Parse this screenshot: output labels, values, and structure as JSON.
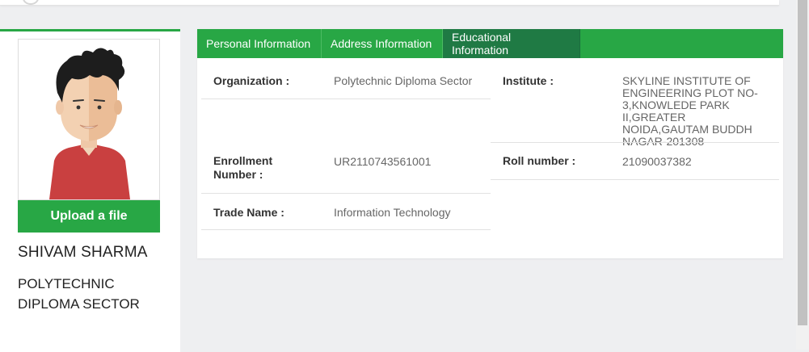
{
  "profile": {
    "name": "SHIVAM SHARMA",
    "organization": "POLYTECHNIC DIPLOMA SECTOR",
    "upload_label": "Upload a file"
  },
  "tabs": [
    {
      "label": "Personal Information",
      "active": false
    },
    {
      "label": "Address Information",
      "active": false
    },
    {
      "label": "Educational Information",
      "active": true
    }
  ],
  "fields": {
    "organization": {
      "label": "Organization :",
      "value": "Polytechnic Diploma Sector"
    },
    "institute": {
      "label": "Institute :",
      "value": "SKYLINE INSTITUTE OF ENGINEERING PLOT NO-3,KNOWLEDE PARK II,GREATER NOIDA,GAUTAM BUDDH NAGAR-201308"
    },
    "enrollment": {
      "label": "Enrollment Number :",
      "value": "UR2110743561001"
    },
    "roll_number": {
      "label": "Roll number :",
      "value": "21090037382"
    },
    "trade_name": {
      "label": "Trade Name :",
      "value": "Information Technology"
    }
  },
  "colors": {
    "accent": "#28a745",
    "active_tab": "#1f7a44"
  }
}
